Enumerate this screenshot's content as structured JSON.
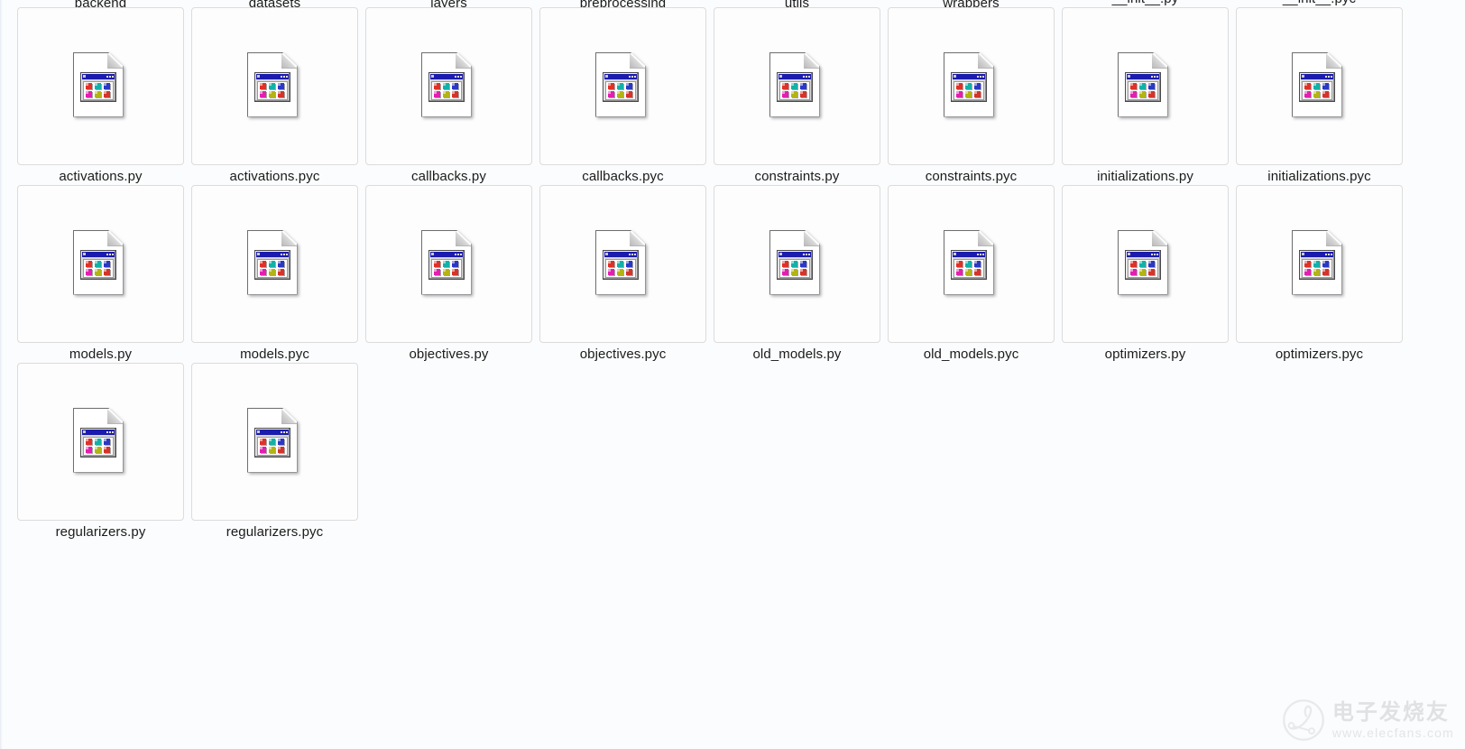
{
  "view": {
    "mode": "extra-large-icons",
    "background_color": "#fbfcfd",
    "tile_border_color": "#dcdcdc",
    "label_color": "#1b1b1b",
    "columns": 8
  },
  "items": [
    {
      "name": "backend",
      "type": "folder",
      "icon": "folder-open-icon"
    },
    {
      "name": "datasets",
      "type": "folder",
      "icon": "folder-open-icon"
    },
    {
      "name": "layers",
      "type": "folder",
      "icon": "folder-open-icon"
    },
    {
      "name": "preprocessing",
      "type": "folder",
      "icon": "folder-open-icon"
    },
    {
      "name": "utils",
      "type": "folder",
      "icon": "folder-open-icon"
    },
    {
      "name": "wrappers",
      "type": "folder",
      "icon": "folder-open-icon"
    },
    {
      "name": "__init__.py",
      "type": "file",
      "icon": "generic-file-icon"
    },
    {
      "name": "__init__.pyc",
      "type": "file",
      "icon": "generic-file-icon"
    },
    {
      "name": "activations.py",
      "type": "file",
      "icon": "generic-file-icon"
    },
    {
      "name": "activations.pyc",
      "type": "file",
      "icon": "generic-file-icon"
    },
    {
      "name": "callbacks.py",
      "type": "file",
      "icon": "generic-file-icon"
    },
    {
      "name": "callbacks.pyc",
      "type": "file",
      "icon": "generic-file-icon"
    },
    {
      "name": "constraints.py",
      "type": "file",
      "icon": "generic-file-icon"
    },
    {
      "name": "constraints.pyc",
      "type": "file",
      "icon": "generic-file-icon"
    },
    {
      "name": "initializations.py",
      "type": "file",
      "icon": "generic-file-icon"
    },
    {
      "name": "initializations.pyc",
      "type": "file",
      "icon": "generic-file-icon"
    },
    {
      "name": "models.py",
      "type": "file",
      "icon": "generic-file-icon"
    },
    {
      "name": "models.pyc",
      "type": "file",
      "icon": "generic-file-icon"
    },
    {
      "name": "objectives.py",
      "type": "file",
      "icon": "generic-file-icon"
    },
    {
      "name": "objectives.pyc",
      "type": "file",
      "icon": "generic-file-icon"
    },
    {
      "name": "old_models.py",
      "type": "file",
      "icon": "generic-file-icon"
    },
    {
      "name": "old_models.pyc",
      "type": "file",
      "icon": "generic-file-icon"
    },
    {
      "name": "optimizers.py",
      "type": "file",
      "icon": "generic-file-icon"
    },
    {
      "name": "optimizers.pyc",
      "type": "file",
      "icon": "generic-file-icon"
    },
    {
      "name": "regularizers.py",
      "type": "file",
      "icon": "generic-file-icon"
    },
    {
      "name": "regularizers.pyc",
      "type": "file",
      "icon": "generic-file-icon"
    }
  ],
  "file_icon": {
    "chip_colors": [
      "#e03127",
      "#14b0a8",
      "#2b38c4",
      "#e31fb0",
      "#b2b416",
      "#d4342a"
    ],
    "titlebar_color": "#1b1bad",
    "page_color": "#ffffff"
  },
  "watermark": {
    "text_cn": "电子发烧友",
    "text_url": "www.elecfans.com",
    "logo": "circle-circuit-logo"
  }
}
